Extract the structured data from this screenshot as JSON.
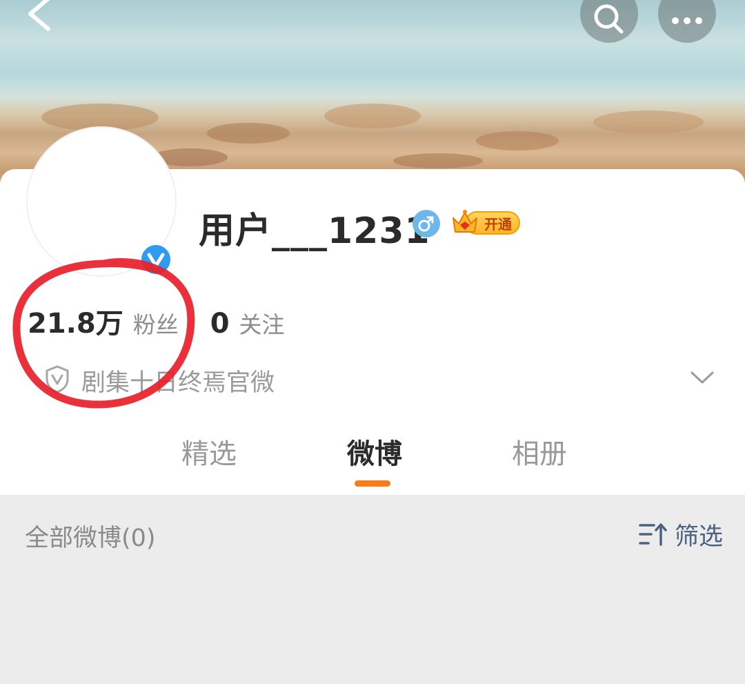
{
  "profile": {
    "username": "用户___1231",
    "gender_icon": "male-icon",
    "vip_badge_label": "开通",
    "followers": {
      "count": "21.8万",
      "label": "粉丝"
    },
    "following": {
      "count": "0",
      "label": "关注"
    },
    "bio": "剧集十日终焉官微"
  },
  "tabs": [
    {
      "label": "精选",
      "active": false
    },
    {
      "label": "微博",
      "active": true
    },
    {
      "label": "相册",
      "active": false
    }
  ],
  "feed": {
    "title": "全部微博(0)",
    "filter_label": "筛选"
  },
  "icons": {
    "back": "back-arrow-icon",
    "search": "search-icon",
    "more": "more-icon",
    "verified": "verified-v-icon",
    "bio_shield": "shield-v-icon",
    "chevron": "chevron-down-icon",
    "filter": "filter-sort-icon"
  },
  "colors": {
    "accent_orange": "#ff7a14",
    "verified_blue": "#2f9af2",
    "gender_blue": "#6db7ea",
    "vip_gold": "#ffb52a",
    "filter_blue": "#4b6283",
    "annotation_red": "#e8202a"
  }
}
